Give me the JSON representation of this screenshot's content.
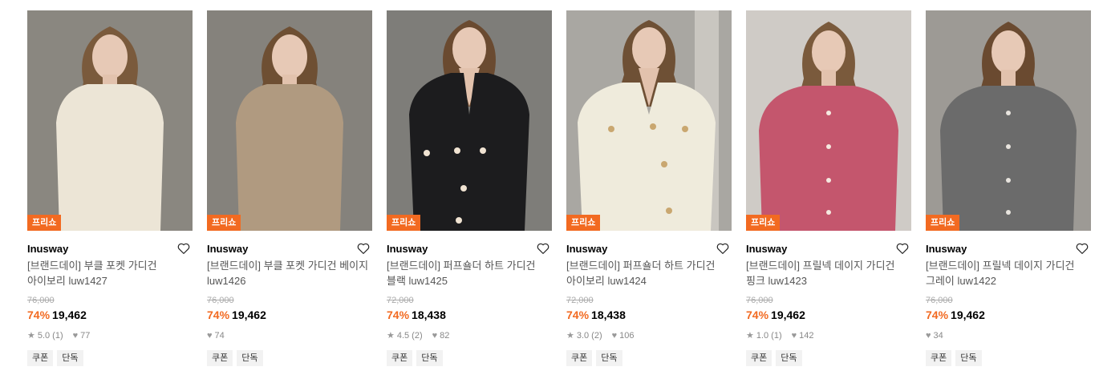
{
  "products": [
    {
      "badge": "프리쇼",
      "brand": "Inusway",
      "title": "[브랜드데이] 부클 포켓 가디건 아이보리 luw1427",
      "original_price": "76,000",
      "discount": "74%",
      "price": "19,462",
      "rating": "5.0",
      "reviews": "(1)",
      "likes": "77",
      "tags": [
        "쿠폰",
        "단독"
      ],
      "colors": {
        "bg": "#8a8780",
        "garment": "#ece5d6",
        "hair": "#7a5a3c"
      }
    },
    {
      "badge": "프리쇼",
      "brand": "Inusway",
      "title": "[브랜드데이] 부클 포켓 가디건 베이지 luw1426",
      "original_price": "76,000",
      "discount": "74%",
      "price": "19,462",
      "rating": "",
      "reviews": "",
      "likes": "74",
      "tags": [
        "쿠폰",
        "단독"
      ],
      "colors": {
        "bg": "#85827c",
        "garment": "#b09a80",
        "hair": "#6e4f33"
      }
    },
    {
      "badge": "프리쇼",
      "brand": "Inusway",
      "title": "[브랜드데이] 퍼프숄더 하트 가디건 블랙 luw1425",
      "original_price": "72,000",
      "discount": "74%",
      "price": "18,438",
      "rating": "4.5",
      "reviews": "(2)",
      "likes": "82",
      "tags": [
        "쿠폰",
        "단독"
      ],
      "colors": {
        "bg": "#7e7d79",
        "garment": "#1c1c1e",
        "hair": "#6a4a30"
      }
    },
    {
      "badge": "프리쇼",
      "brand": "Inusway",
      "title": "[브랜드데이] 퍼프숄더 하트 가디건 아이보리 luw1424",
      "original_price": "72,000",
      "discount": "74%",
      "price": "18,438",
      "rating": "3.0",
      "reviews": "(2)",
      "likes": "106",
      "tags": [
        "쿠폰",
        "단독"
      ],
      "colors": {
        "bg": "#a9a7a2",
        "garment": "#efebdc",
        "hair": "#6e5035"
      }
    },
    {
      "badge": "프리쇼",
      "brand": "Inusway",
      "title": "[브랜드데이] 프릴넥 데이지 가디건 핑크 luw1423",
      "original_price": "76,000",
      "discount": "74%",
      "price": "19,462",
      "rating": "1.0",
      "reviews": "(1)",
      "likes": "142",
      "tags": [
        "쿠폰",
        "단독"
      ],
      "colors": {
        "bg": "#cfcbc6",
        "garment": "#c4566d",
        "hair": "#7a5a3c"
      }
    },
    {
      "badge": "프리쇼",
      "brand": "Inusway",
      "title": "[브랜드데이] 프릴넥 데이지 가디건 그레이 luw1422",
      "original_price": "76,000",
      "discount": "74%",
      "price": "19,462",
      "rating": "",
      "reviews": "",
      "likes": "34",
      "tags": [
        "쿠폰",
        "단독"
      ],
      "colors": {
        "bg": "#9d9a95",
        "garment": "#6b6b6b",
        "hair": "#6a4a30"
      }
    }
  ],
  "icons": {
    "star": "star-icon",
    "heart": "heart-icon",
    "wishlist": "heart-outline-icon"
  },
  "accent_color": "#f26a21"
}
